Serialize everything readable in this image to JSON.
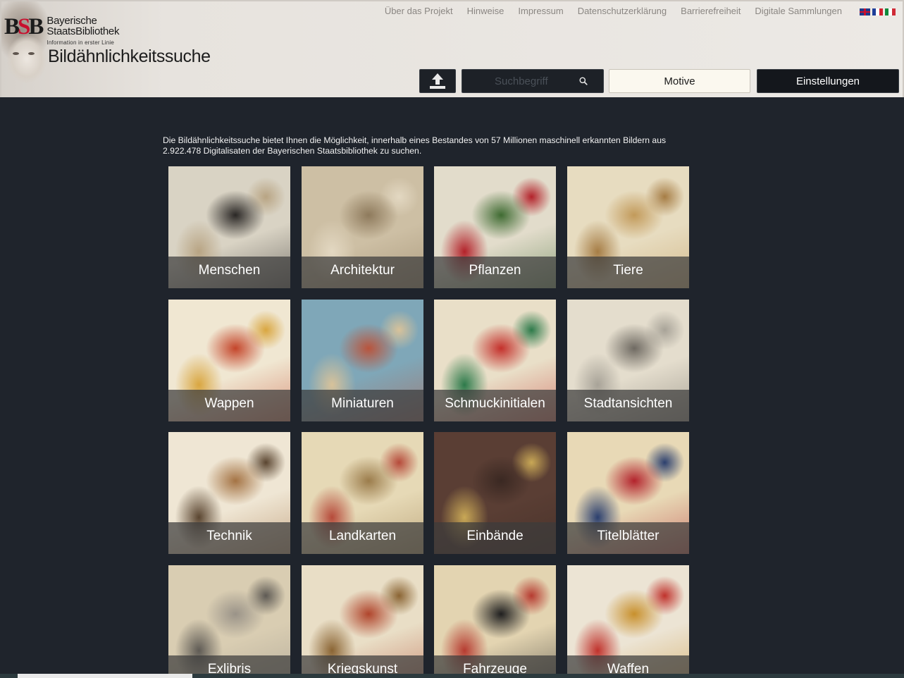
{
  "header": {
    "logo_mark": "BSB",
    "logo_name_line1": "Bayerische",
    "logo_name_line2": "StaatsBibliothek",
    "logo_tagline": "Information in erster Linie",
    "app_title": "Bildähnlichkeitssuche",
    "nav": [
      "Über das Projekt",
      "Hinweise",
      "Impressum",
      "Datenschutzerklärung",
      "Barrierefreiheit",
      "Digitale Sammlungen"
    ],
    "languages": [
      "en",
      "fr",
      "it"
    ]
  },
  "toolbar": {
    "upload_icon": "upload-icon",
    "search_placeholder": "Suchbegriff",
    "search_icon": "search-icon",
    "motive_label": "Motive",
    "settings_label": "Einstellungen"
  },
  "intro": "Die Bildähnlichkeitssuche bietet Ihnen die Möglichkeit, innerhalb eines Bestandes von 57 Millionen maschinell erkannten Bildern aus 2.922.478 Digitalisaten der Bayerischen Staatsbibliothek zu suchen.",
  "categories": [
    {
      "label": "Menschen",
      "colors": [
        "#d9d3c4",
        "#2a2725",
        "#b8a483"
      ]
    },
    {
      "label": "Architektur",
      "colors": [
        "#cdbfa4",
        "#8e7a5c",
        "#e3d8c2"
      ]
    },
    {
      "label": "Pflanzen",
      "colors": [
        "#e2dccb",
        "#3f6b32",
        "#b3222a"
      ]
    },
    {
      "label": "Tiere",
      "colors": [
        "#e7dcc0",
        "#c29a5a",
        "#a67d45"
      ]
    },
    {
      "label": "Wappen",
      "colors": [
        "#f0e7d2",
        "#c4452a",
        "#d9a640"
      ]
    },
    {
      "label": "Miniaturen",
      "colors": [
        "#7fa7b8",
        "#b9543c",
        "#d8c29a"
      ]
    },
    {
      "label": "Schmuckinitialen",
      "colors": [
        "#e9dfc8",
        "#c4302b",
        "#2d7a4a"
      ]
    },
    {
      "label": "Stadtansichten",
      "colors": [
        "#e4ddcd",
        "#6f6a62",
        "#a8a398"
      ]
    },
    {
      "label": "Technik",
      "colors": [
        "#efe6d4",
        "#a47344",
        "#5a4530"
      ]
    },
    {
      "label": "Landkarten",
      "colors": [
        "#e6d9b6",
        "#9b7c4b",
        "#b64a3a"
      ]
    },
    {
      "label": "Einbände",
      "colors": [
        "#5a3e34",
        "#3a2822",
        "#c9a856"
      ]
    },
    {
      "label": "Titelblätter",
      "colors": [
        "#e8d9b6",
        "#b3232c",
        "#2b3f6e"
      ]
    },
    {
      "label": "Exlibris",
      "colors": [
        "#d9cdb2",
        "#9a9388",
        "#5e5a54"
      ]
    },
    {
      "label": "Kriegskunst",
      "colors": [
        "#e9dec6",
        "#b0452c",
        "#8a6433"
      ]
    },
    {
      "label": "Fahrzeuge",
      "colors": [
        "#e3d4b1",
        "#1f1f1f",
        "#b63b30"
      ]
    },
    {
      "label": "Waffen",
      "colors": [
        "#ece4d4",
        "#c8902c",
        "#c0322c"
      ]
    }
  ]
}
